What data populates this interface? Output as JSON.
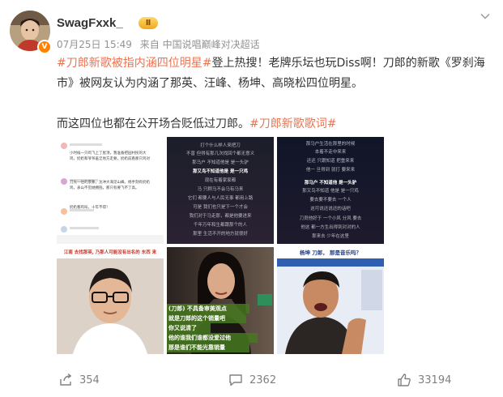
{
  "post": {
    "username": "SwagFxxk_",
    "badge": "Ⅱ",
    "timestamp": "07月25日 15:49",
    "source": "来自 中国说唱巅峰对决超话",
    "text": {
      "tag1": "#刀郎新歌被指内涵四位明星#",
      "line1_rest": "登上热搜！老牌乐坛也玩Diss啊！刀郎的新歌《罗刹海市》被网友认为内涵了那英、汪峰、杨坤、高晓松四位明星。",
      "line2": "而这四位也都在公开场合贬低过刀郎。",
      "tag2": "#刀郎新歌歌词#"
    }
  },
  "images": {
    "img1_lines": [
      "小时候一只鸡飞上了屋顶，我准备把园村民的大",
      "鸡，奶奶和爷爷羞涩地方走要，奶奶前看那只鸡对",
      "刀光一往的景象，沈冲大海见山峰。杨手刻有奶奶",
      "鸡，表山不见她拥抱，那只有要飞不了高。",
      "奶奶看鸡叫，十年不得！"
    ],
    "img2_lyrics": [
      "打个什么样人来把刀",
      "不曾 但得有那几次找回个都无意义",
      "那马户 不知道他是 是一头驴",
      "那又鸟不知道他是 是一只鸡",
      "现在有着家家都",
      "马 只顾马不会马有马来",
      "它们 都要人与人民无事 都用上路",
      "可是 我们也只是下一个才会",
      "我们对于马走那，都是他要进来",
      "千年万年和生都跟那个的人",
      "那里 生活不开的地方就很好"
    ],
    "img3_lyrics": [
      "那马户生活在那里的时候",
      "本着不走中来来",
      "还还 只跟知道 把重来来",
      "他一 旦得到 就打 要来来",
      "那马户 不知道他 是一头驴",
      "那又鸟不知道 他是 是一只鸡",
      "要去要不要去 一个人",
      "这可说还说还的话吧",
      "刀员他好于 一个小风 分风 要去",
      "他这 都一方生出得到对对的人",
      "那来去 少年在这里"
    ],
    "img4_caption": "江南 去找那英, 乃那人可能没有出名的 东西 来",
    "img6_caption": "杨坤 刀郎， 那是音乐吗？",
    "img5_subs": [
      "(刀郎) 不具备审美观点",
      "就是刀郎的这个销量吧",
      "你又说清了",
      "他的谁我们谁都没爱过他",
      "那是谁们不能光靠销量"
    ]
  },
  "footer": {
    "repost_count": "354",
    "comment_count": "2362",
    "like_count": "33194"
  },
  "colors": {
    "tag": "#eb7350",
    "meta": "#939393",
    "badge": "#f0a81c"
  },
  "icons": [
    "chevron-down-icon",
    "repost-icon",
    "comment-icon",
    "like-icon",
    "vip-icon"
  ]
}
